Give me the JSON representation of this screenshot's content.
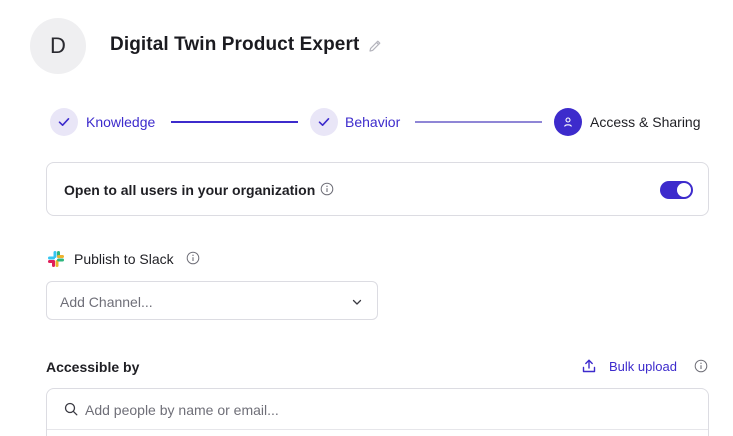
{
  "agent": {
    "avatar_letter": "D",
    "name": "Digital Twin Product Expert",
    "edit_icon": "pencil-icon"
  },
  "stepper": {
    "steps": [
      {
        "label": "Knowledge",
        "state": "completed",
        "icon": "check-icon"
      },
      {
        "label": "Behavior",
        "state": "completed",
        "icon": "check-icon"
      },
      {
        "label": "Access & Sharing",
        "state": "active",
        "icon": "user-icon"
      }
    ]
  },
  "org_access": {
    "label": "Open to all users in your organization",
    "info_icon": "info-icon",
    "toggle_on": true
  },
  "slack": {
    "label": "Publish to Slack",
    "icon": "slack-logo-icon",
    "info_icon": "info-icon",
    "channel_placeholder": "Add Channel...",
    "dropdown_icon": "chevron-down-icon"
  },
  "access": {
    "label": "Accessible by",
    "bulk_upload_label": "Bulk upload",
    "bulk_upload_icon": "upload-icon",
    "info_icon": "info-icon",
    "search_placeholder": "Add people by name or email...",
    "search_icon": "search-icon"
  },
  "colors": {
    "accent": "#3d2bcc",
    "accent_light": "#e9e6f7",
    "border": "#dcdce2",
    "muted_text": "#6f6f78"
  }
}
